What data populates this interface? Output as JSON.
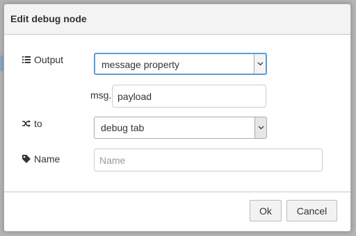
{
  "dialog": {
    "title": "Edit debug node"
  },
  "output_row": {
    "label": "Output",
    "icon": "list-icon",
    "select_value": "message property"
  },
  "property_row": {
    "prefix": "msg.",
    "value": "payload"
  },
  "to_row": {
    "label": "to",
    "icon": "random-icon",
    "select_value": "debug tab"
  },
  "name_row": {
    "label": "Name",
    "icon": "tag-icon",
    "placeholder": "Name",
    "value": ""
  },
  "buttons": {
    "ok_label": "Ok",
    "cancel_label": "Cancel"
  }
}
